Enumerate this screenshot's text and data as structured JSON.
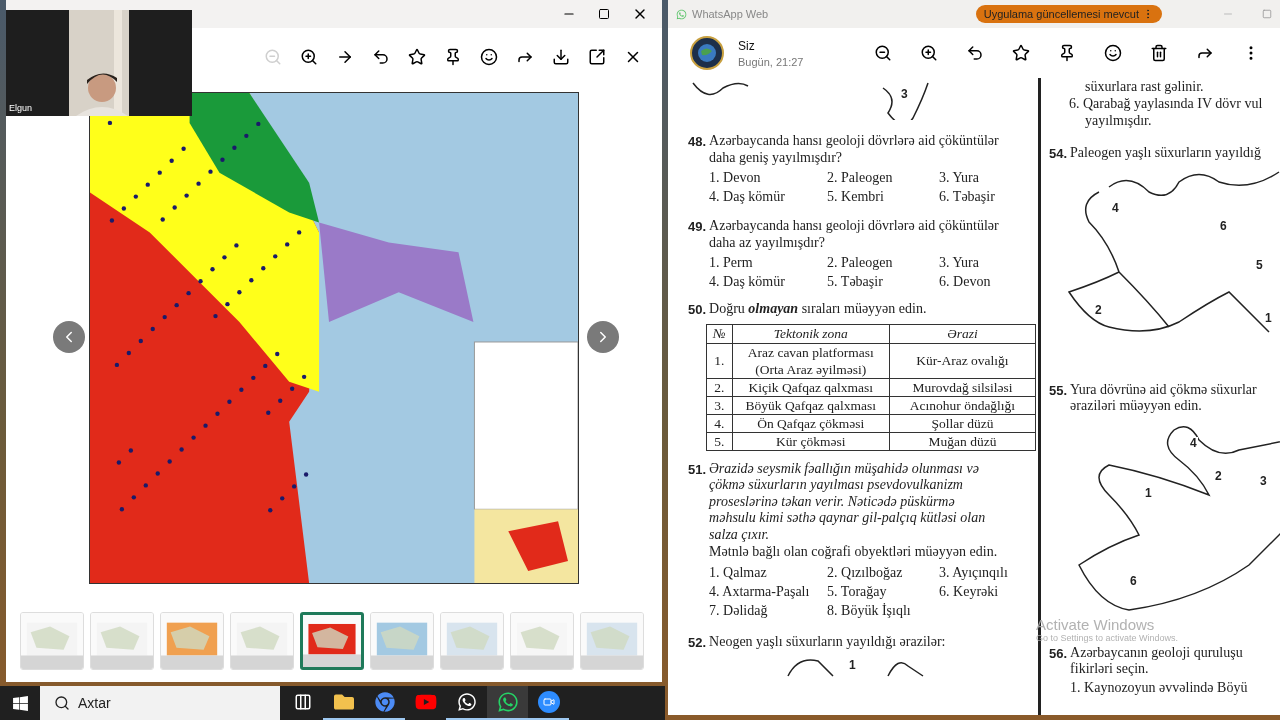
{
  "viewer": {
    "zoom_out": {
      "disabled": true
    },
    "webcam": {
      "name": "Elgun"
    },
    "thumbnails": [
      {
        "selected": false
      },
      {
        "selected": false
      },
      {
        "selected": false
      },
      {
        "selected": false
      },
      {
        "selected": true
      },
      {
        "selected": false
      },
      {
        "selected": false
      },
      {
        "selected": false
      },
      {
        "selected": false
      }
    ]
  },
  "whatsapp": {
    "title": "WhatsApp Web",
    "update_badge": "Uygulama güncellemesi mevcut",
    "chat": {
      "name": "Siz",
      "time": "Bugün, 21:27"
    },
    "document": {
      "left_column": [
        {
          "kind": "sketch",
          "labels": [
            "3"
          ]
        },
        {
          "kind": "question",
          "number": "48.",
          "italic": false,
          "text_lines": [
            "Azərbaycanda hansı geoloji dövrlərə aid çöküntülər",
            "daha geniş yayılmışdır?"
          ],
          "options": [
            "1. Devon",
            "2. Paleogen",
            "3. Yura",
            "4. Daş kömür",
            "5. Kembri",
            "6. Təbaşir"
          ]
        },
        {
          "kind": "question",
          "number": "49.",
          "italic": false,
          "text_lines": [
            "Azərbaycanda hansı geoloji dövrlərə aid çöküntülər",
            "daha az yayılmışdır?"
          ],
          "options": [
            "1. Perm",
            "2. Paleogen",
            "3. Yura",
            "4. Daş kömür",
            "5. Təbaşir",
            "6. Devon"
          ]
        },
        {
          "kind": "question",
          "number": "50.",
          "italic": false,
          "text_lines": [
            "Doğru *olmayan* sıraları müəyyən edin."
          ],
          "table": {
            "columns": [
              "№",
              "Tektonik zona",
              "Ərazi"
            ],
            "rows": [
              [
                "1.",
                "Araz cavan platforması (Orta Araz əyilməsi)",
                "Kür-Araz ovalığı"
              ],
              [
                "2.",
                "Kiçik Qafqaz qalxması",
                "Murovdağ silsiləsi"
              ],
              [
                "3.",
                "Böyük Qafqaz qalxması",
                "Acınohur öndağlığı"
              ],
              [
                "4.",
                "Ön Qafqaz çökməsi",
                "Şollar düzü"
              ],
              [
                "5.",
                "Kür çökməsi",
                "Muğan düzü"
              ]
            ]
          }
        },
        {
          "kind": "question",
          "number": "51.",
          "italic": true,
          "text_lines": [
            "Ərazidə seysmik fəallığın müşahidə olunması və",
            "çökmə süxurların yayılması psevdovulkanizm",
            "proseslərinə təkan verir. Nəticədə püskürmə",
            "məhsulu kimi səthə qaynar gil-palçıq kütləsi olan",
            "salza çıxır."
          ],
          "prompt": "Mətnlə bağlı olan coğrafi obyektləri müəyyən edin.",
          "options": [
            "1. Qalmaz",
            "2. Qızılboğaz",
            "3. Ayıçınqılı",
            "4. Axtarma-Paşalı",
            "5. Torağay",
            "6. Keyrəki",
            "7. Dəlidağ",
            "8. Böyük İşıqlı"
          ]
        },
        {
          "kind": "question",
          "number": "52.",
          "italic": false,
          "text_lines": [
            "Neogen yaşlı süxurların yayıldığı ərazilər:"
          ]
        },
        {
          "kind": "sketch",
          "labels": [
            "1"
          ]
        }
      ],
      "right_column": [
        {
          "kind": "continuation",
          "text_lines": [
            "süxurlara rast gəlinir."
          ]
        },
        {
          "kind": "list_item",
          "text_lines": [
            "6. Qarabağ yaylasında IV dövr vul",
            "yayılmışdır."
          ]
        },
        {
          "kind": "question",
          "number": "54.",
          "italic": false,
          "text_lines": [
            "Paleogen yaşlı süxurların yayıldığ"
          ]
        },
        {
          "kind": "sketch",
          "labels": [
            "4",
            "6",
            "5",
            "2",
            "1"
          ]
        },
        {
          "kind": "question",
          "number": "55.",
          "italic": false,
          "text_lines": [
            "Yura dövrünə aid çökmə süxurlar",
            "əraziləri müəyyən edin."
          ]
        },
        {
          "kind": "sketch",
          "labels": [
            "4",
            "2",
            "3",
            "1",
            "6"
          ]
        },
        {
          "kind": "question",
          "number": "56.",
          "italic": false,
          "text_lines": [
            "Azərbaycanın geoloji quruluşu",
            "fikirləri seçin."
          ],
          "items": [
            "1. Kaynozoyun əvvəlində Böyü"
          ]
        }
      ]
    }
  },
  "os_notice": {
    "title": "Activate Windows",
    "hint": "Go to Settings to activate Windows."
  },
  "taskbar": {
    "search": {
      "placeholder": "Axtar"
    },
    "apps": [
      {
        "kind": "task-view",
        "open": false,
        "selected": false
      },
      {
        "kind": "files",
        "open": true,
        "selected": false
      },
      {
        "kind": "browser",
        "open": true,
        "selected": false
      },
      {
        "kind": "video",
        "open": false,
        "selected": false
      },
      {
        "kind": "chat-light",
        "open": true,
        "selected": false
      },
      {
        "kind": "chat",
        "open": true,
        "selected": true
      },
      {
        "kind": "meeting",
        "open": true,
        "selected": false
      }
    ]
  }
}
